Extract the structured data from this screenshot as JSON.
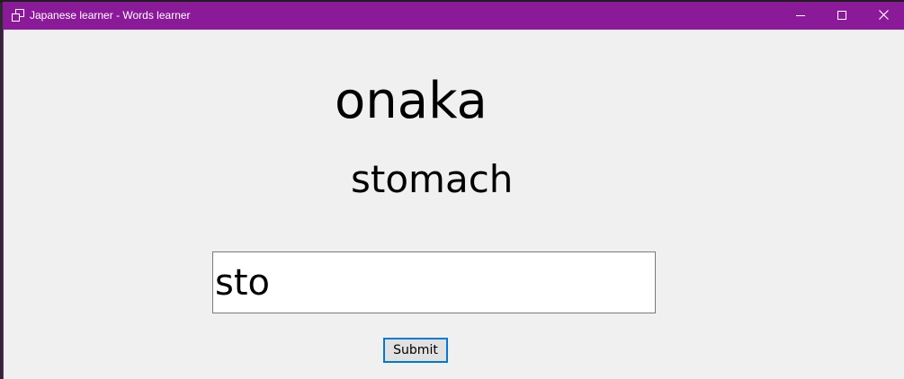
{
  "window": {
    "title": "Japanese learner - Words learner",
    "titlebar_color": "#8b1a99",
    "controls": {
      "minimize_icon": "minimize-icon",
      "maximize_icon": "maximize-icon",
      "close_icon": "close-icon"
    }
  },
  "main": {
    "japanese_word": "onaka",
    "english_word": "stomach",
    "answer_input": {
      "value": "sto",
      "placeholder": ""
    },
    "submit_label": "Submit"
  }
}
